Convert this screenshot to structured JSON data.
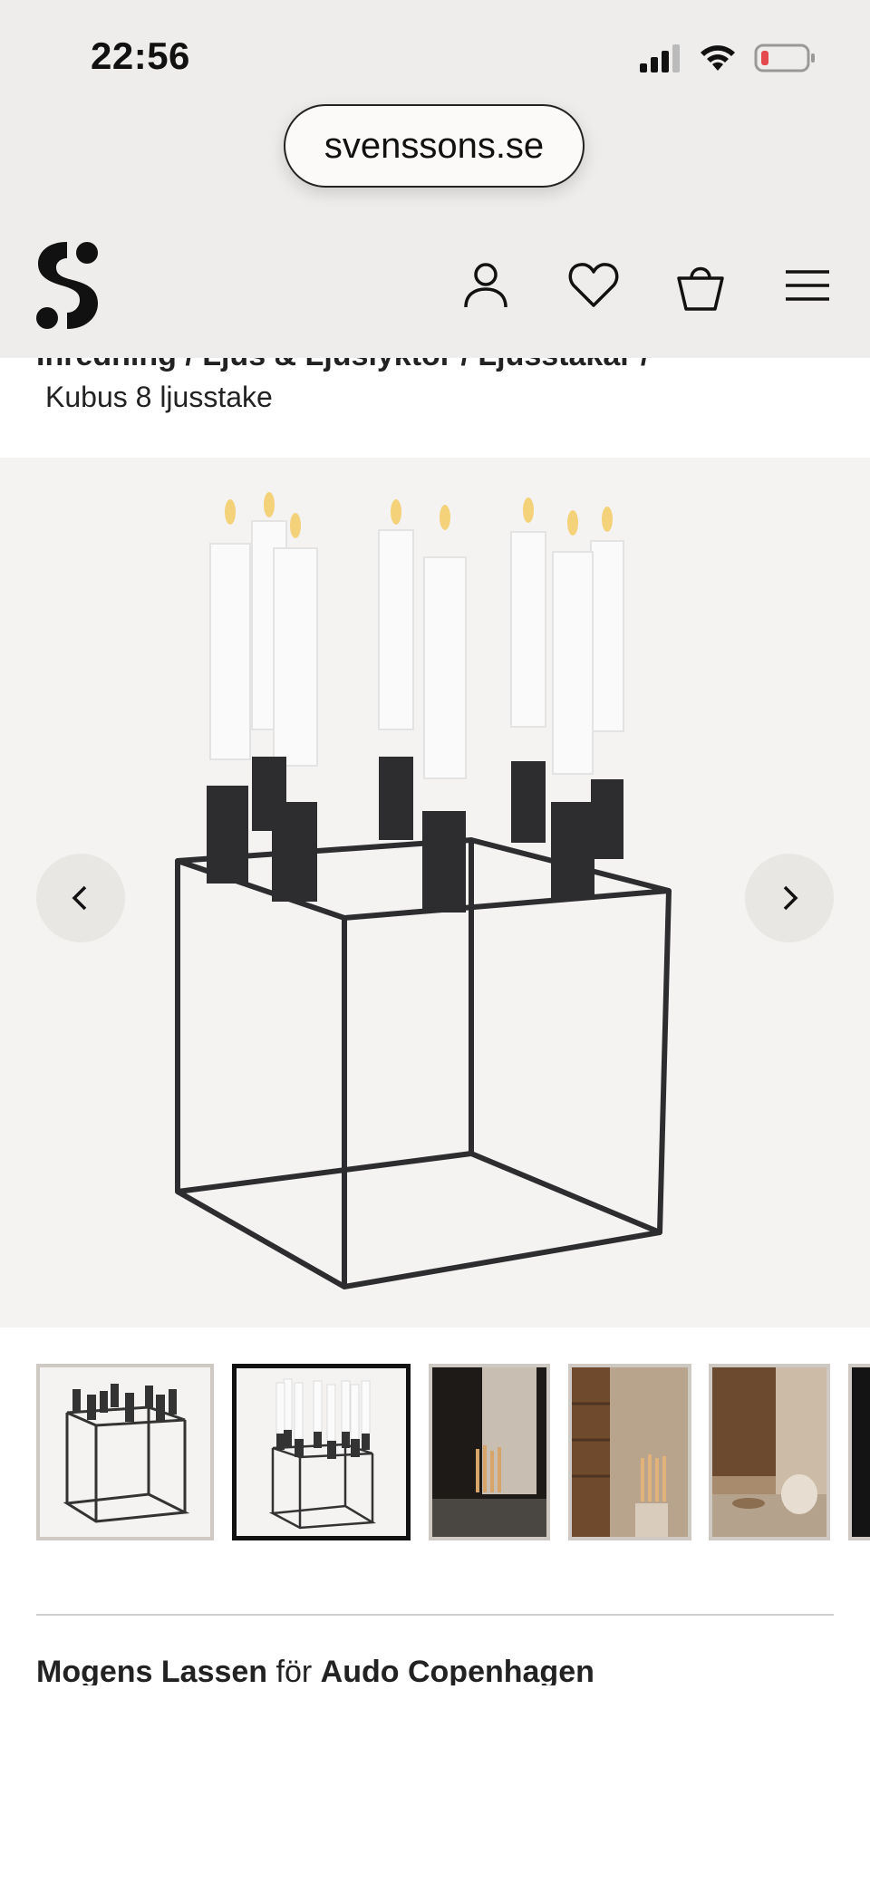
{
  "status_bar": {
    "time": "22:56"
  },
  "browser": {
    "url": "svenssons.se"
  },
  "nav": {
    "logo": "s-logo",
    "icons": [
      "user-icon",
      "heart-icon",
      "bag-icon",
      "menu-icon"
    ]
  },
  "breadcrumb": {
    "trail": "Inredning / Ljus & Ljuslyktor / Ljusstakar /",
    "current": "Kubus 8 ljusstake"
  },
  "gallery": {
    "main_image": "Kubus 8 ljusstake product photo",
    "active_index": 1,
    "thumbnails": [
      "thumb-1",
      "thumb-2",
      "thumb-3",
      "thumb-4",
      "thumb-5",
      "thumb-6"
    ]
  },
  "designer": {
    "name": "Mogens Lassen",
    "connector": "för",
    "brand": "Audo Copenhagen"
  },
  "colors": {
    "header_bg": "#efedeb",
    "accent": "#111111",
    "battery_low": "#e5484d"
  }
}
